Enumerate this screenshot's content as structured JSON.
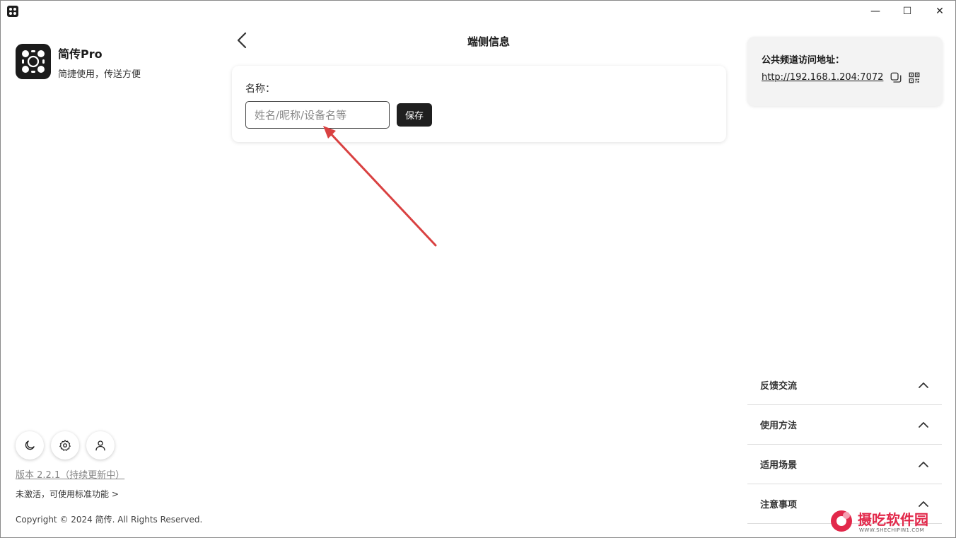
{
  "window": {
    "minimize": "—",
    "maximize": "☐",
    "close": "✕"
  },
  "sidebar": {
    "app_name": "简传Pro",
    "slogan": "简捷使用，传送方便",
    "version": "版本 2.2.1（持续更新中）",
    "activation": "未激活，可使用标准功能 >",
    "copyright": "Copyright © 2024 简传. All Rights Reserved.",
    "icons": [
      "moon-icon",
      "gear-icon",
      "user-icon"
    ]
  },
  "main": {
    "title": "端侧信息",
    "form": {
      "name_label": "名称：",
      "name_placeholder": "姓名/昵称/设备名等",
      "name_value": "",
      "save_label": "保存"
    }
  },
  "right": {
    "addr_title": "公共频道访问地址：",
    "addr_url": "http://192.168.1.204:7072",
    "accordion": [
      {
        "label": "反馈交流"
      },
      {
        "label": "使用方法"
      },
      {
        "label": "适用场景"
      },
      {
        "label": "注意事项"
      }
    ]
  },
  "watermark": {
    "text": "摄吃软件园",
    "sub": "WWW.SHECHIPIN1.COM"
  },
  "colors": {
    "accent_dark": "#1f1f1f",
    "arrow": "#d94141",
    "watermark": "#e2284a"
  }
}
